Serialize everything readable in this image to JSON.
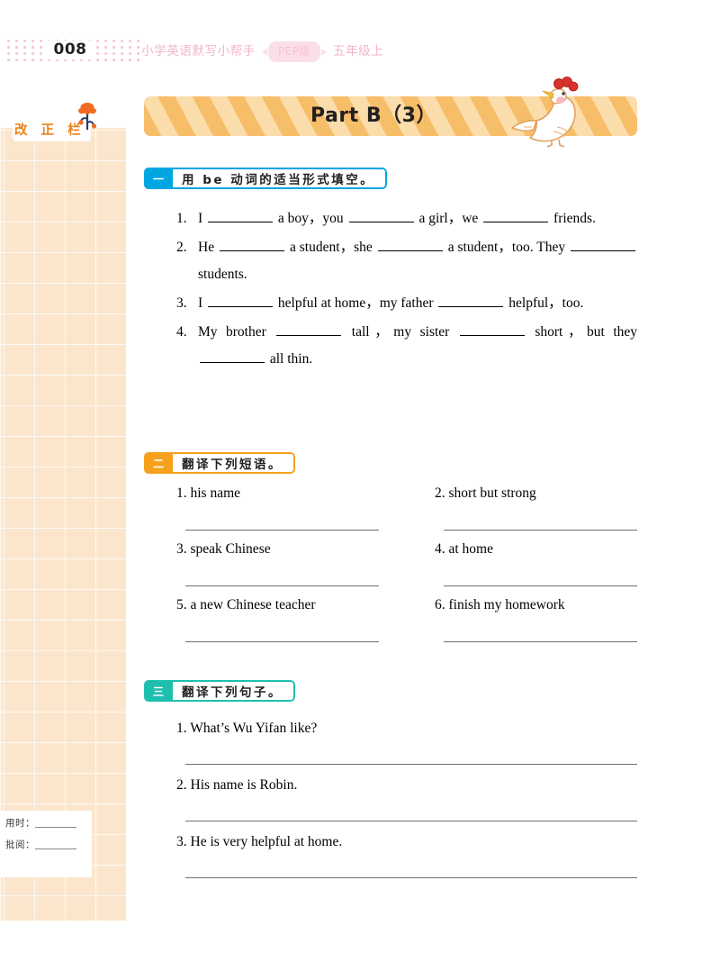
{
  "header": {
    "page_number": "008",
    "book_title": "小学英语默写小帮手",
    "edition_badge": "PEP版",
    "grade": "五年级上"
  },
  "sidebar": {
    "label": "改 正 栏",
    "flower_icon": "flower-icon",
    "footer": {
      "time_label": "用时：",
      "review_label": "批阅："
    }
  },
  "banner": {
    "title": "Part B（3）",
    "mascot_icon": "chicken-icon"
  },
  "exercises": [
    {
      "number": "一",
      "title": "用 be 动词的适当形式填空。",
      "accent": "#00a6e2",
      "type": "fill-blank",
      "items": [
        {
          "num": "1.",
          "parts": [
            "I",
            "a  boy，you",
            "a  girl，we",
            "friends."
          ]
        },
        {
          "num": "2.",
          "parts": [
            "He",
            "a student，she",
            "a student，too. They",
            "students."
          ]
        },
        {
          "num": "3.",
          "parts": [
            "I",
            "helpful at home，my father",
            "helpful，too."
          ]
        },
        {
          "num": "4.",
          "parts": [
            "My brother",
            "tall，my sister",
            "short，but they",
            "all thin."
          ]
        }
      ]
    },
    {
      "number": "二",
      "title": "翻译下列短语。",
      "accent": "#f5a11e",
      "type": "phrase-translation",
      "items": [
        {
          "num": "1.",
          "text": "his name"
        },
        {
          "num": "2.",
          "text": "short but strong"
        },
        {
          "num": "3.",
          "text": "speak Chinese"
        },
        {
          "num": "4.",
          "text": "at home"
        },
        {
          "num": "5.",
          "text": "a new Chinese teacher"
        },
        {
          "num": "6.",
          "text": "finish my homework"
        }
      ]
    },
    {
      "number": "三",
      "title": "翻译下列句子。",
      "accent": "#1fbfae",
      "type": "sentence-translation",
      "items": [
        {
          "num": "1.",
          "text": "What’s Wu Yifan like?"
        },
        {
          "num": "2.",
          "text": "His name is Robin."
        },
        {
          "num": "3.",
          "text": "He is very helpful at home."
        }
      ]
    }
  ]
}
